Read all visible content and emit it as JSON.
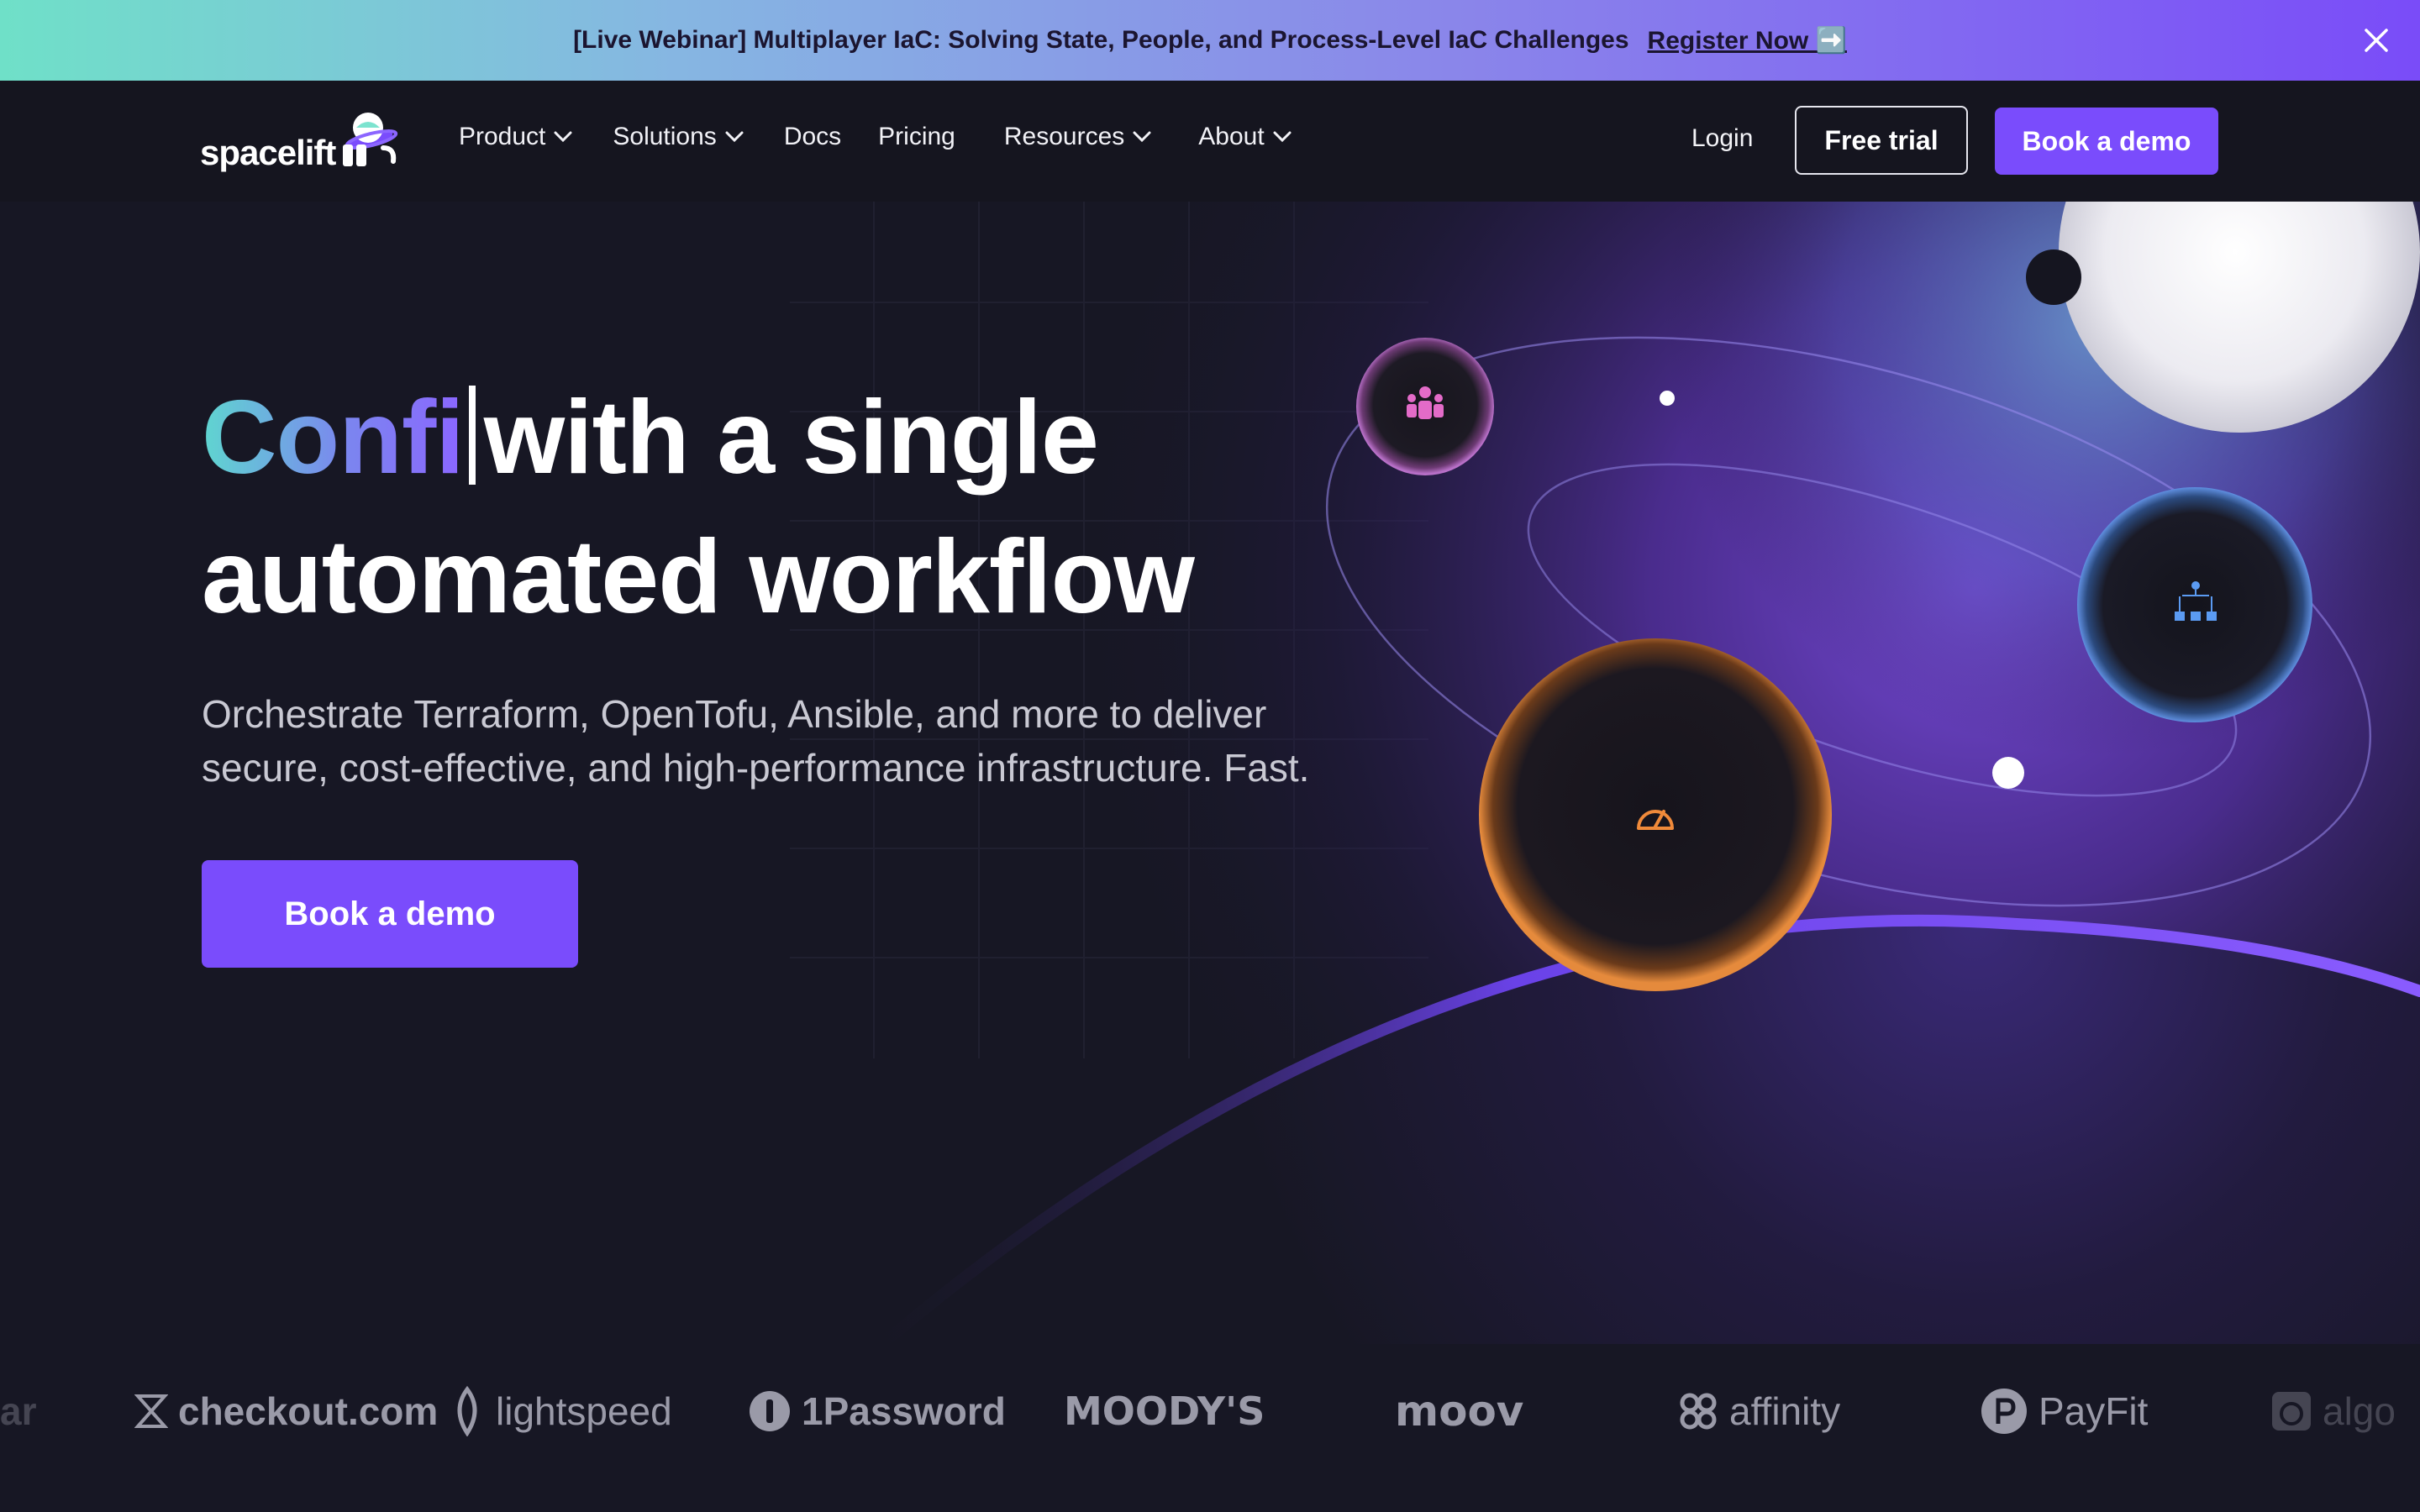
{
  "banner": {
    "text": "[Live Webinar] Multiplayer IaC: Solving State, People, and Process-Level IaC Challenges",
    "cta": "Register Now ➡️",
    "close_icon": "close-icon"
  },
  "nav": {
    "logo_text": "spacelift",
    "items": [
      {
        "label": "Product",
        "has_dropdown": true
      },
      {
        "label": "Solutions",
        "has_dropdown": true
      },
      {
        "label": "Docs",
        "has_dropdown": false
      },
      {
        "label": "Pricing",
        "has_dropdown": false
      },
      {
        "label": "Resources",
        "has_dropdown": true
      },
      {
        "label": "About",
        "has_dropdown": true
      }
    ],
    "login": "Login",
    "free_trial": "Free trial",
    "book_demo": "Book a demo"
  },
  "hero": {
    "headline_typed": "Confi",
    "headline_rest_line1": "with a single",
    "headline_line2": "automated workflow",
    "subtitle_line1": "Orchestrate Terraform, OpenTofu, Ansible, and more to deliver",
    "subtitle_line2": "secure, cost-effective, and high-performance infrastructure. Fast.",
    "cta": "Book a demo",
    "planet_icons": [
      "team-icon",
      "hierarchy-icon",
      "speedometer-icon"
    ]
  },
  "customers": [
    {
      "name": "ar",
      "icon": ""
    },
    {
      "name": "checkout.com",
      "icon": "checkout-icon"
    },
    {
      "name": "lightspeed",
      "icon": "lightspeed-icon"
    },
    {
      "name": "1Password",
      "icon": "onepassword-icon"
    },
    {
      "name": "MOODY'S",
      "icon": ""
    },
    {
      "name": "moov",
      "icon": ""
    },
    {
      "name": "affinity",
      "icon": "affinity-icon"
    },
    {
      "name": "PayFit",
      "icon": "payfit-icon"
    },
    {
      "name": "algo",
      "icon": "algo-icon"
    }
  ],
  "colors": {
    "background": "#171724",
    "accent": "#7a4cfc",
    "banner_start": "#6fe0c8",
    "banner_end": "#7a4cf8"
  }
}
